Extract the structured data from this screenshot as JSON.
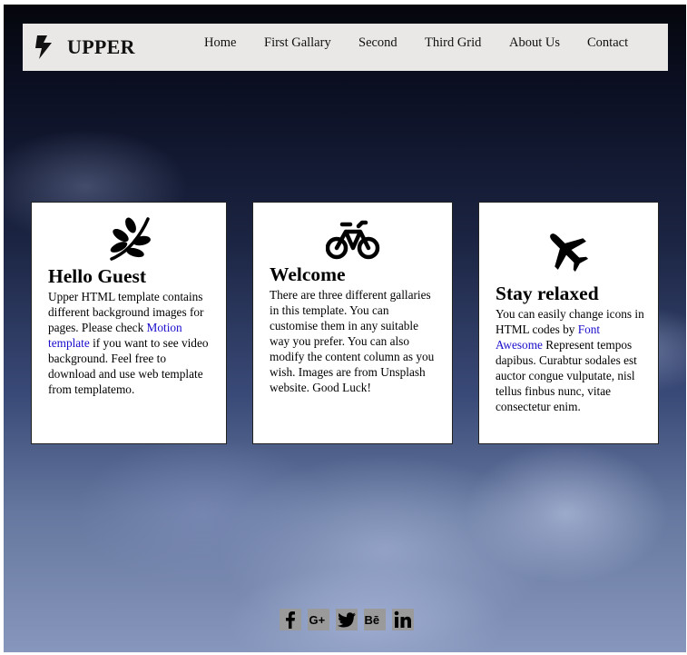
{
  "brand": {
    "name": "UPPER",
    "icon": "bolt-icon"
  },
  "nav": {
    "items": [
      "Home",
      "First Gallary",
      "Second",
      "Third Grid",
      "About Us",
      "Contact"
    ]
  },
  "cards": [
    {
      "icon": "leaf-icon",
      "title": "Hello Guest",
      "text_before": "Upper HTML template contains different background images for pages. Please check ",
      "link": "Motion template",
      "text_after": " if you want to see video background. Feel free to download and use web template from templatemo."
    },
    {
      "icon": "bicycle-icon",
      "title": "Welcome",
      "text": "There are three different gallaries in this template. You can customise them in any suitable way you prefer. You can also modify the content column as you wish. Images are from Unsplash website. Good Luck!"
    },
    {
      "icon": "plane-icon",
      "title": "Stay relaxed",
      "text_before": "You can easily change icons in HTML codes by ",
      "link": "Font Awesome",
      "text_after": " Represent tempos dapibus. Curabtur sodales est auctor congue vulputate, nisl tellus finbus nunc, vitae consectetur enim."
    }
  ],
  "social": [
    "facebook-icon",
    "google-plus-icon",
    "twitter-icon",
    "behance-icon",
    "linkedin-icon"
  ],
  "colors": {
    "navbar_bg": "#e9e8e6",
    "link": "#1a0dcc",
    "card_bg": "#ffffff"
  }
}
